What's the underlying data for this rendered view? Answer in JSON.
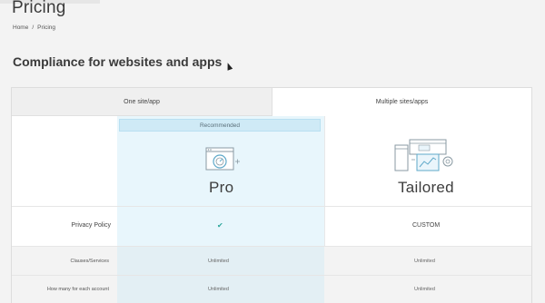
{
  "page": {
    "title": "Pricing",
    "breadcrumb": [
      "Home",
      "/",
      "Pricing"
    ],
    "section_title": "Compliance for websites and apps"
  },
  "tabs": [
    {
      "label": "One site/app",
      "selected": false
    },
    {
      "label": "Multiple sites/apps",
      "selected": true
    }
  ],
  "plans": {
    "recommended_label": "Recommended",
    "pro": {
      "name": "Pro",
      "icon": "gauge-window-icon"
    },
    "tailored": {
      "name": "Tailored",
      "icon": "multi-screens-gear-icon"
    }
  },
  "features": [
    {
      "label": "Privacy Policy",
      "pro": "✔",
      "tailored": "CUSTOM"
    },
    {
      "label": "Clauses/Services",
      "pro": "Unlimited",
      "tailored": "Unlimited"
    },
    {
      "label": "How many for each account",
      "pro": "Unlimited",
      "tailored": "Unlimited"
    }
  ],
  "colors": {
    "accent_light": "#e8f6fc",
    "recommended_bg": "#cfeaf6",
    "check": "#2aa69a"
  }
}
